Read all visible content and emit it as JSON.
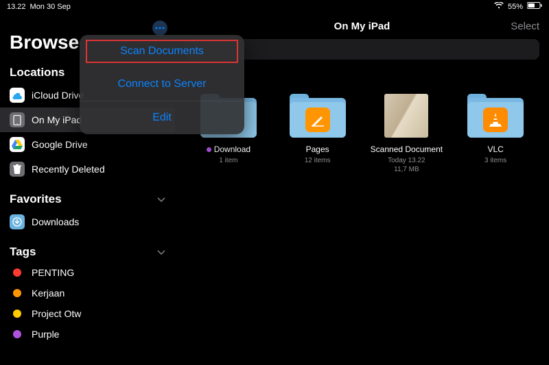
{
  "status": {
    "time": "13.22",
    "date": "Mon 30 Sep",
    "battery": "55%"
  },
  "sidebar": {
    "title": "Browse",
    "sections": {
      "locations": {
        "title": "Locations",
        "items": [
          {
            "label": "iCloud Drive",
            "icon": "icloud",
            "color": "#ffffff"
          },
          {
            "label": "On My iPad",
            "icon": "ipad",
            "color": "#6e6e72",
            "selected": true
          },
          {
            "label": "Google Drive",
            "icon": "gdrive",
            "color": "#ffffff"
          },
          {
            "label": "Recently Deleted",
            "icon": "trash",
            "color": "#6e6e72"
          }
        ]
      },
      "favorites": {
        "title": "Favorites",
        "items": [
          {
            "label": "Downloads",
            "icon": "folder",
            "color": "#79b8e3"
          }
        ]
      },
      "tags": {
        "title": "Tags",
        "items": [
          {
            "label": "PENTING",
            "color": "#ff3b30"
          },
          {
            "label": "Kerjaan",
            "color": "#ff9500"
          },
          {
            "label": "Project Otw",
            "color": "#ffcc00"
          },
          {
            "label": "Purple",
            "color": "#af52de"
          }
        ]
      }
    }
  },
  "main": {
    "title": "On My iPad",
    "select": "Select",
    "items": [
      {
        "name": "Download",
        "meta1": "1 item",
        "tag_color": "#af52de",
        "type": "folder"
      },
      {
        "name": "Pages",
        "meta1": "12 items",
        "type": "folder",
        "app": "pages",
        "app_bg": "#ff9500"
      },
      {
        "name": "Scanned Document",
        "meta1": "Today 13.22",
        "meta2": "11,7 MB",
        "type": "scan"
      },
      {
        "name": "VLC",
        "meta1": "3 items",
        "type": "folder",
        "app": "vlc",
        "app_bg": "#ff9500"
      }
    ]
  },
  "popover": {
    "items": [
      {
        "label": "Scan Documents",
        "highlighted": true
      },
      {
        "label": "Connect to Server"
      },
      {
        "label": "Edit"
      }
    ]
  }
}
